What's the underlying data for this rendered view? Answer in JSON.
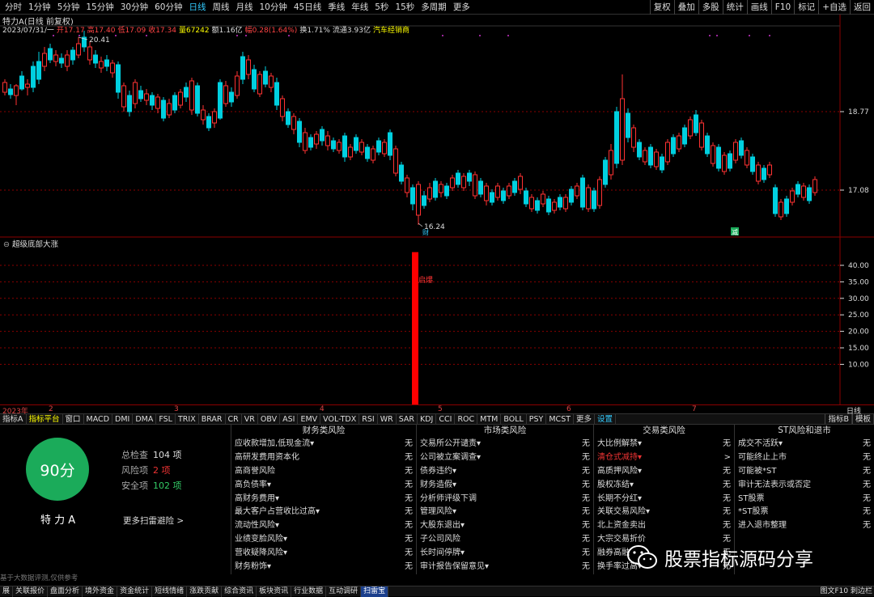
{
  "toolbar": {
    "periods": [
      "分时",
      "1分钟",
      "5分钟",
      "15分钟",
      "30分钟",
      "60分钟",
      "日线",
      "周线",
      "月线",
      "10分钟",
      "45日线",
      "季线",
      "年线",
      "5秒",
      "15秒",
      "多周期",
      "更多"
    ],
    "active_period": "日线",
    "right_buttons": [
      "复权",
      "叠加",
      "多股",
      "统计",
      "画线",
      "F10",
      "标记",
      "+自选",
      "返回"
    ]
  },
  "info": {
    "title": "特力A(日线 前复权)",
    "date": "2023/07/31/一",
    "open_label": "开17.17",
    "high_label": "高17.40",
    "low_label": "低17.09",
    "close_label": "收17.34",
    "volume_label": "量67242",
    "amount_label": "额1.16亿",
    "change_label": "幅0.28(1.64%)",
    "turnover_label": "换1.71%",
    "float_cap_label": "流通3.93亿",
    "industry_label": "汽车经销商"
  },
  "chart_data": {
    "type": "candlestick",
    "price_axis_labels": [
      "18.77",
      "17.08"
    ],
    "high_marker": "20.41",
    "low_marker": "16.24",
    "event_marks": [
      "财",
      "减"
    ],
    "indicator": {
      "title": "超级底部大涨",
      "axis_labels": [
        "40.00",
        "35.00",
        "30.00",
        "25.00",
        "20.00",
        "15.00",
        "10.00"
      ],
      "signal_label": "启爆",
      "signal_value": 44
    },
    "x_labels": [
      "2023年",
      "2",
      "3",
      "4",
      "5",
      "6",
      "7"
    ],
    "period_label": "日线"
  },
  "indicator_tabs": [
    "指标A",
    "指标平台",
    "窗口",
    "MACD",
    "DMI",
    "DMA",
    "FSL",
    "TRIX",
    "BRAR",
    "CR",
    "VR",
    "OBV",
    "ASI",
    "EMV",
    "VOL-TDX",
    "RSI",
    "WR",
    "SAR",
    "KDJ",
    "CCI",
    "ROC",
    "MTM",
    "BOLL",
    "PSY",
    "MCST",
    "更多",
    "设置"
  ],
  "indicator_tabs_right": [
    "指标B",
    "模板"
  ],
  "risk": {
    "score": "90分",
    "stock_name": "特 力 A",
    "total_label": "总检查",
    "total_value": "104 项",
    "risk_label": "风险项",
    "risk_value": "2 项",
    "safe_label": "安全项",
    "safe_value": "102 项",
    "more_scan": "更多扫雷避险 >",
    "disclaimer": "基于大数据评测,仅供参考",
    "columns": [
      {
        "title": "财务类风险",
        "items": [
          {
            "name": "应收款增加,低现金流▾",
            "value": "无"
          },
          {
            "name": "高研发费用资本化",
            "value": "无"
          },
          {
            "name": "高商誉风险",
            "value": "无"
          },
          {
            "name": "高负债率▾",
            "value": "无"
          },
          {
            "name": "高财务费用▾",
            "value": "无"
          },
          {
            "name": "最大客户占营收比过高▾",
            "value": "无"
          },
          {
            "name": "流动性风险▾",
            "value": "无"
          },
          {
            "name": "业绩变脸风险▾",
            "value": "无"
          },
          {
            "name": "营收疑降风险▾",
            "value": "无"
          },
          {
            "name": "财务粉饰▾",
            "value": "无"
          }
        ]
      },
      {
        "title": "市场类风险",
        "items": [
          {
            "name": "交易所公开谴责▾",
            "value": "无"
          },
          {
            "name": "公司被立案调查▾",
            "value": "无"
          },
          {
            "name": "债券违约▾",
            "value": "无"
          },
          {
            "name": "财务造假▾",
            "value": "无"
          },
          {
            "name": "分析师评级下调",
            "value": "无"
          },
          {
            "name": "管理风险▾",
            "value": "无"
          },
          {
            "name": "大股东退出▾",
            "value": "无"
          },
          {
            "name": "子公司风险",
            "value": "无"
          },
          {
            "name": "长时间停牌▾",
            "value": "无"
          },
          {
            "name": "审计报告保留意见▾",
            "value": "无"
          }
        ]
      },
      {
        "title": "交易类风险",
        "items": [
          {
            "name": "大比例解禁▾",
            "value": "无"
          },
          {
            "name": "清仓式减持▾",
            "value": ">",
            "warn": true
          },
          {
            "name": "高质押风险▾",
            "value": "无"
          },
          {
            "name": "股权冻结▾",
            "value": "无"
          },
          {
            "name": "长期不分红▾",
            "value": "无"
          },
          {
            "name": "关联交易风险▾",
            "value": "无"
          },
          {
            "name": "北上资金卖出",
            "value": "无"
          },
          {
            "name": "大宗交易折价",
            "value": "无"
          },
          {
            "name": "融券高融",
            "value": "无"
          },
          {
            "name": "换手率过高▾",
            "value": "无"
          }
        ]
      },
      {
        "title": "ST风险和退市",
        "items": [
          {
            "name": "成交不活跃▾",
            "value": "无"
          },
          {
            "name": "可能终止上市",
            "value": "无"
          },
          {
            "name": "可能被*ST",
            "value": "无"
          },
          {
            "name": "审计无法表示或否定",
            "value": "无"
          },
          {
            "name": "ST股票",
            "value": "无"
          },
          {
            "name": "*ST股票",
            "value": "无"
          },
          {
            "name": "进入退市整理",
            "value": "无"
          },
          {
            "name": "",
            "value": ""
          },
          {
            "name": "",
            "value": ""
          },
          {
            "name": "",
            "value": ""
          }
        ]
      }
    ]
  },
  "bottom_tabs": [
    "展",
    "关联报价",
    "盘面分析",
    "境外资金",
    "资金统计",
    "短线情绪",
    "涨跌贡献",
    "综合资讯",
    "板块资讯",
    "行业数据",
    "互动调研",
    "扫雷宝"
  ],
  "bottom_active": "扫雷宝",
  "bottom_right": "图文F10 刺边栏",
  "watermark": "股票指标源码分享",
  "colors": {
    "up": "#ff3232",
    "down": "#00d0e0",
    "grid": "#8b0000",
    "score_bg": "#1bab5a",
    "signal": "#ff0000"
  }
}
